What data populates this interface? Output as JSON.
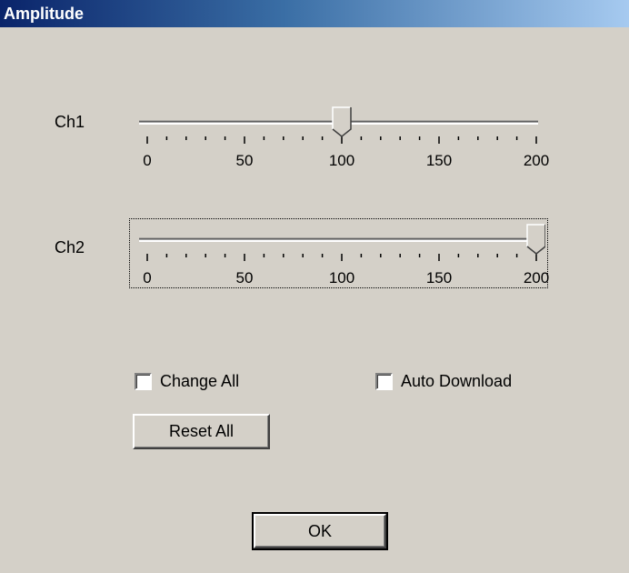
{
  "window": {
    "title": "Amplitude"
  },
  "sliders": [
    {
      "label": "Ch1",
      "value": 100,
      "min": 0,
      "max": 200,
      "tick_step": 10,
      "tick_labels": [
        "0",
        "50",
        "100",
        "150",
        "200"
      ]
    },
    {
      "label": "Ch2",
      "value": 200,
      "min": 0,
      "max": 200,
      "tick_step": 10,
      "tick_labels": [
        "0",
        "50",
        "100",
        "150",
        "200"
      ]
    }
  ],
  "options": {
    "change_all": {
      "label": "Change All",
      "checked": false
    },
    "auto_download": {
      "label": "Auto Download",
      "checked": false
    }
  },
  "buttons": {
    "reset_all": "Reset All",
    "ok": "OK"
  },
  "colors": {
    "title_start": "#0a246a",
    "title_end": "#a6caf0",
    "face": "#d4d0c8"
  }
}
